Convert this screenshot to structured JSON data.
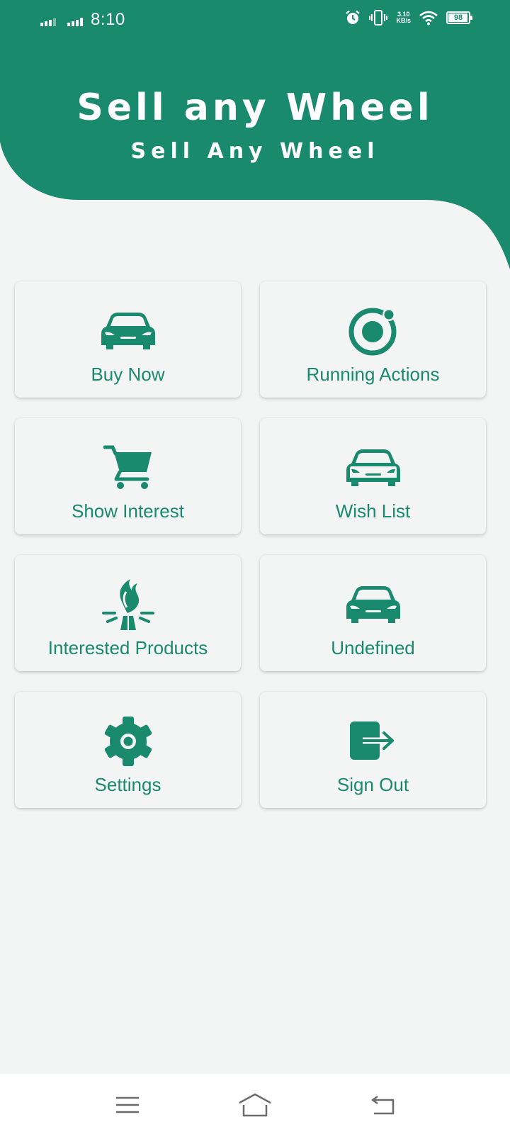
{
  "status": {
    "time": "8:10",
    "net_speed_value": "3.10",
    "net_speed_unit": "KB/s",
    "battery": "98",
    "battery_level": 0.98
  },
  "header": {
    "title": "Sell any Wheel",
    "subtitle": "Sell Any Wheel"
  },
  "menu": {
    "items": [
      {
        "label": "Buy Now",
        "icon": "car-icon"
      },
      {
        "label": "Running Actions",
        "icon": "ionic-logo-icon"
      },
      {
        "label": "Show Interest",
        "icon": "cart-icon"
      },
      {
        "label": "Wish List",
        "icon": "car-outline-icon"
      },
      {
        "label": "Interested Products",
        "icon": "bonfire-icon"
      },
      {
        "label": "Undefined",
        "icon": "car-icon"
      },
      {
        "label": "Settings",
        "icon": "gear-icon"
      },
      {
        "label": "Sign Out",
        "icon": "sign-out-icon"
      }
    ]
  },
  "colors": {
    "primary": "#1a8a6f",
    "background": "#f3f4f4",
    "nav_bar": "#ffffff"
  }
}
